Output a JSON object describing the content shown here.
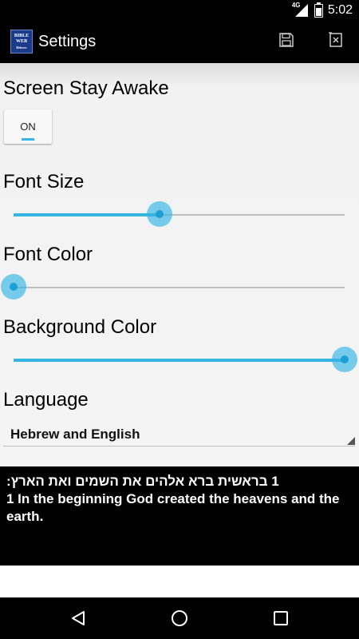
{
  "status_bar": {
    "network": "4G",
    "time": "5:02"
  },
  "app_bar": {
    "logo_line1": "BIBLE",
    "logo_line2": "WEB",
    "logo_line3": "Hebrew",
    "title": "Settings",
    "save_icon": "save-icon",
    "close_icon": "close-icon"
  },
  "settings": {
    "screen_stay_awake": {
      "label": "Screen Stay Awake",
      "toggle_value": "ON"
    },
    "font_size": {
      "label": "Font Size",
      "value": 0.44
    },
    "font_color": {
      "label": "Font Color",
      "value": 0.0
    },
    "background_color": {
      "label": "Background Color",
      "value": 1.0
    },
    "language": {
      "label": "Language",
      "selected": "Hebrew and English"
    }
  },
  "preview": {
    "hebrew": "1 בראשית ברא אלהים את השמים ואת הארץ:",
    "english": "1 In the beginning God created the heavens and the earth."
  },
  "colors": {
    "accent": "#33b5e5",
    "background": "#f2f2f2",
    "bars": "#000000"
  },
  "nav_bar": {
    "back_icon": "back-icon",
    "home_icon": "home-icon",
    "recents_icon": "recents-icon"
  }
}
